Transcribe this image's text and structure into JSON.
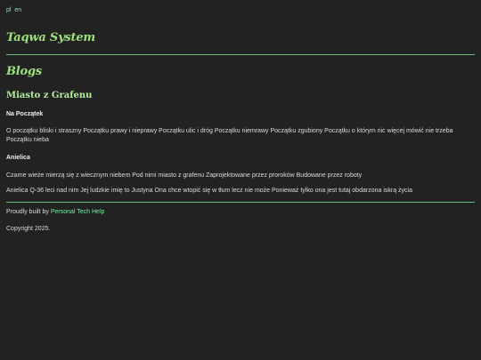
{
  "lang": [
    "pl",
    "en"
  ],
  "site_title": "Taqwa System",
  "section_title": "Blogs",
  "post": {
    "title": "Miasto z Grafenu",
    "blocks": [
      {
        "type": "heading",
        "text": "Na Początek"
      },
      {
        "type": "para",
        "text": "O początku bliski i straszny Początku prawy i nieprawy Początku ulic i dróg Początku niemrawy Początku zgubiony Początku o którym nic więcej mówić nie trzeba Początku nieba"
      },
      {
        "type": "heading",
        "text": "Anielica"
      },
      {
        "type": "para",
        "text": "Czarne wieże mierzą się z wiecznym niebem Pod nimi miasto z grafenu Zaprojektowane przez proroków Budowane przez roboty"
      },
      {
        "type": "para",
        "text": "Anielica Q-36 leci nad nim Jej ludzkie imię to Justyna Ona chce wtopić się w tłum lecz nie może Ponieważ tylko ona jest tutaj obdarzona iskrą życia"
      }
    ]
  },
  "footer": {
    "built_prefix": "Proudly built by",
    "built_link": "Personal Tech Help",
    "copyright": "Copyright 2025."
  }
}
